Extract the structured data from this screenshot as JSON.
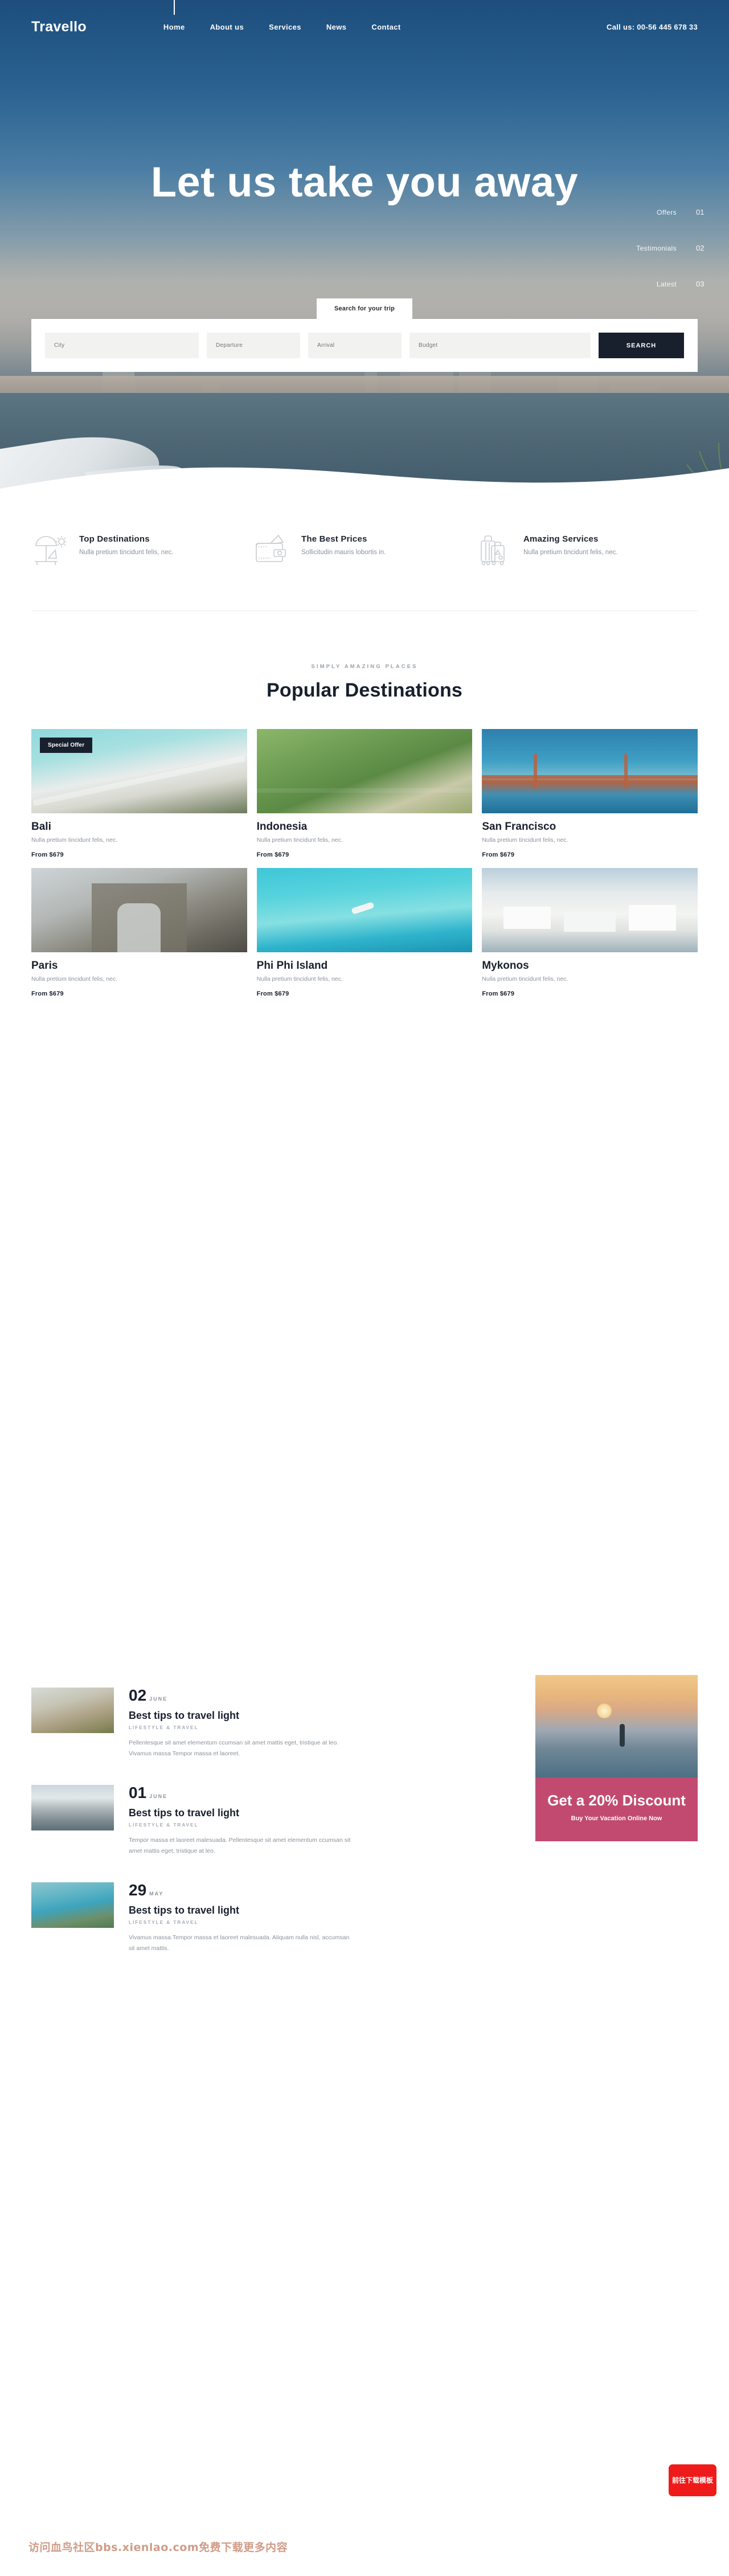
{
  "brand": "Travello",
  "nav": {
    "items": [
      {
        "label": "Home",
        "active": true
      },
      {
        "label": "About us",
        "active": false
      },
      {
        "label": "Services",
        "active": false
      },
      {
        "label": "News",
        "active": false
      },
      {
        "label": "Contact",
        "active": false
      }
    ],
    "call_us": "Call us: 00-56 445 678 33"
  },
  "hero": {
    "title": "Let us take you away",
    "section_nav": [
      {
        "label": "Offers",
        "num": "01"
      },
      {
        "label": "Testimonials",
        "num": "02"
      },
      {
        "label": "Latest",
        "num": "03"
      }
    ]
  },
  "search": {
    "tab_label": "Search for your trip",
    "fields": [
      {
        "name": "city",
        "placeholder": "City",
        "value": ""
      },
      {
        "name": "departure",
        "placeholder": "Departure",
        "value": ""
      },
      {
        "name": "arrival",
        "placeholder": "Arrival",
        "value": ""
      },
      {
        "name": "budget",
        "placeholder": "Budget",
        "value": ""
      }
    ],
    "button_label": "SEARCH"
  },
  "features": [
    {
      "icon": "beach-umbrella-icon",
      "title": "Top Destinations",
      "text": "Nulla pretium tincidunt felis, nec."
    },
    {
      "icon": "wallet-icon",
      "title": "The Best Prices",
      "text": "Sollicitudin mauris lobortis in."
    },
    {
      "icon": "luggage-icon",
      "title": "Amazing Services",
      "text": "Nulla pretium tincidunt felis, nec."
    }
  ],
  "destinations": {
    "eyebrow": "SIMPLY AMAZING PLACES",
    "title": "Popular Destinations",
    "badge_label": "Special Offer",
    "cards": [
      {
        "name": "Bali",
        "desc": "Nulla pretium tincidunt felis, nec.",
        "price": "From $679",
        "badge": true,
        "thumb": "t-bali"
      },
      {
        "name": "Indonesia",
        "desc": "Nulla pretium tincidunt felis, nec.",
        "price": "From $679",
        "badge": false,
        "thumb": "t-indo"
      },
      {
        "name": "San Francisco",
        "desc": "Nulla pretium tincidunt felis, nec.",
        "price": "From $679",
        "badge": false,
        "thumb": "t-sf"
      },
      {
        "name": "Paris",
        "desc": "Nulla pretium tincidunt felis, nec.",
        "price": "From $679",
        "badge": false,
        "thumb": "t-paris"
      },
      {
        "name": "Phi Phi Island",
        "desc": "Nulla pretium tincidunt felis, nec.",
        "price": "From $679",
        "badge": false,
        "thumb": "t-phi"
      },
      {
        "name": "Mykonos",
        "desc": "Nulla pretium tincidunt felis, nec.",
        "price": "From $679",
        "badge": false,
        "thumb": "t-myk"
      }
    ]
  },
  "latest": {
    "posts": [
      {
        "day": "02",
        "month": "JUNE",
        "title": "Best tips to travel light",
        "category": "LIFESTYLE & TRAVEL",
        "excerpt": "Pellentesque sit amet elementum ccumsan sit amet mattis eget, tristique at leo. Vivamus massa Tempor massa et laoreet.",
        "thumb": "p-camel"
      },
      {
        "day": "01",
        "month": "JUNE",
        "title": "Best tips to travel light",
        "category": "LIFESTYLE & TRAVEL",
        "excerpt": "Tempor massa et laoreet malesuada. Pellentesque sit amet elementum ccumsan sit amet mattis eget, tristique at leo.",
        "thumb": "p-wing"
      },
      {
        "day": "29",
        "month": "MAY",
        "title": "Best tips to travel light",
        "category": "LIFESTYLE & TRAVEL",
        "excerpt": "Vivamus massa.Tempor massa et laoreet malesuada. Aliquam nulla nisl, accumsan sit amet mattis.",
        "thumb": "p-bay"
      }
    ]
  },
  "promo": {
    "headline": "Get a 20% Discount",
    "subline": "Buy Your Vacation Online Now"
  },
  "footer": {
    "watermark": "访问血鸟社区bbs.xienlao.com免费下载更多内容",
    "download_button": "前往下载模板"
  },
  "colors": {
    "dark": "#18202e",
    "promo_pink": "#c24a70",
    "muted": "#8b939c",
    "download_red": "#ef1b1b"
  }
}
